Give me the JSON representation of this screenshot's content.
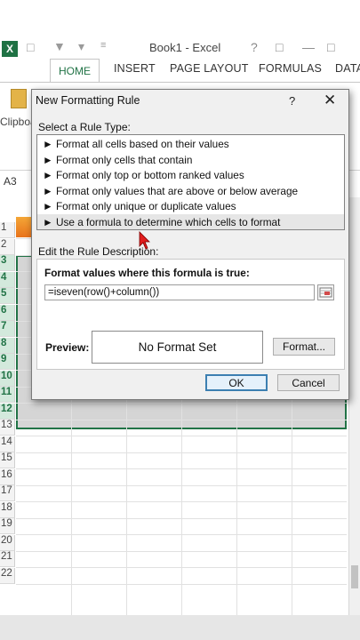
{
  "titlebar": {
    "app_title": "Book1 - Excel",
    "logo": "X"
  },
  "ribbon": {
    "tabs": [
      "HOME",
      "INSERT",
      "PAGE LAYOUT",
      "FORMULAS",
      "DATA"
    ],
    "clipboard_label": "Clipboa"
  },
  "namebox": {
    "value": "A3"
  },
  "grid": {
    "row_numbers": [
      "1",
      "2",
      "3",
      "4",
      "5",
      "6",
      "7",
      "8",
      "9",
      "10",
      "11",
      "12",
      "13",
      "14",
      "15",
      "16",
      "17",
      "18",
      "19",
      "20",
      "21",
      "22"
    ],
    "selected_rows": [
      "3",
      "4",
      "5",
      "6",
      "7",
      "8",
      "9",
      "10",
      "11",
      "12"
    ]
  },
  "dialog": {
    "title": "New Formatting Rule",
    "help": "?",
    "close": "✕",
    "select_label": "Select a Rule Type:",
    "rule_types": [
      "► Format all cells based on their values",
      "► Format only cells that contain",
      "► Format only top or bottom ranked values",
      "► Format only values that are above or below average",
      "► Format only unique or duplicate values",
      "► Use a formula to determine which cells to format"
    ],
    "edit_label": "Edit the Rule Description:",
    "formula_label": "Format values where this formula is true:",
    "formula_value": "=iseven(row()+column())",
    "preview_label": "Preview:",
    "preview_text": "No Format Set",
    "format_button": "Format...",
    "ok_button": "OK",
    "cancel_button": "Cancel"
  },
  "colors": {
    "excel_green": "#217346",
    "selection_gray": "#d5d5d5",
    "dialog_bg": "#f0f0f0"
  }
}
